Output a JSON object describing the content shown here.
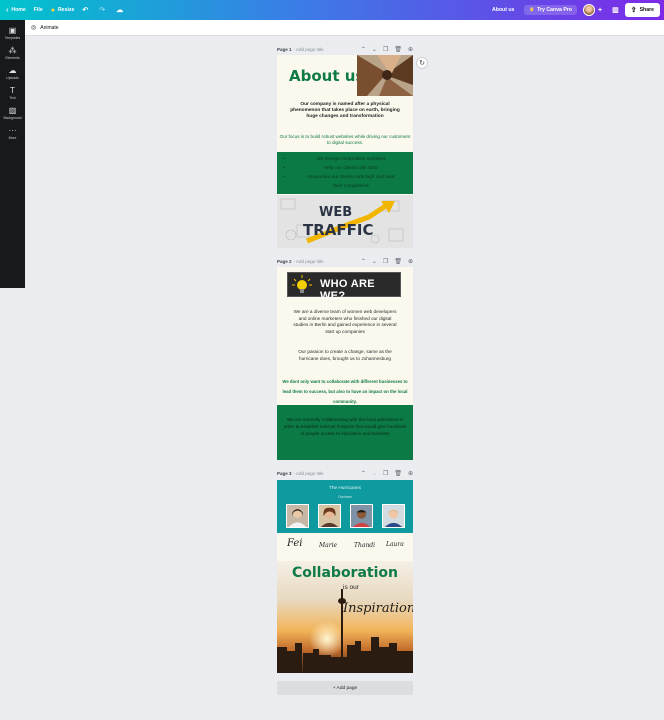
{
  "topbar": {
    "home": "Home",
    "file": "File",
    "resize": "Resize",
    "about": "About us",
    "try_pro": "Try Canva Pro",
    "share": "Share"
  },
  "rail": [
    {
      "label": "Templates",
      "icon": "templates-icon"
    },
    {
      "label": "Elements",
      "icon": "elements-icon"
    },
    {
      "label": "Uploads",
      "icon": "uploads-icon"
    },
    {
      "label": "Text",
      "icon": "text-icon"
    },
    {
      "label": "Background",
      "icon": "background-icon"
    },
    {
      "label": "More",
      "icon": "more-icon"
    }
  ],
  "subbar": {
    "animate": "Animate"
  },
  "pages": [
    {
      "label": "Page 1",
      "title_placeholder": "- Add page title"
    },
    {
      "label": "Page 2",
      "title_placeholder": "- Add page title"
    },
    {
      "label": "Page 3",
      "title_placeholder": "- Add page title"
    }
  ],
  "page1": {
    "title": "About us",
    "desc": "Our company is named after a physical phenomenon that takes place on earth, bringing huge changes and transformation",
    "focus": "Our focus is to build robust websites while driving our customers to digital success.",
    "bullets": [
      "We Design competitive websites",
      "Help our clients with SEO",
      "Guarantee our clients rank high and beat",
      "their competitors"
    ],
    "traffic_line1": "WEB",
    "traffic_line2": "TRAFFIC"
  },
  "page2": {
    "banner": "WHO ARE WE?",
    "t1": "We are a diverse team of women web developers and online marketers who finished our digital studies in Berlin and gained experience in several start up companies",
    "t2": "Our passion to create a change, same as the hurricane does, brought us to Johannesburg",
    "t3": "We dont only want to collaborate with different businesses to lead them to success, but also to have an impact on the local community.",
    "t4": "We are currently collaborating with the local authorities in order to establish internet hotspots that would give hundreds of people access to education and business"
  },
  "page3": {
    "heading": "The Hurricanes",
    "sub": "Our team",
    "names": [
      "Fei",
      "Marie",
      "Thandi",
      "Laura"
    ],
    "collab": "Collaboration",
    "is_our": "is our",
    "inspiration": "Inspiration"
  },
  "add_page": "+ Add page",
  "colors": {
    "brand_green": "#0b7a45",
    "teal": "#0f9aa0",
    "canvas_bg": "#ebecf0"
  }
}
